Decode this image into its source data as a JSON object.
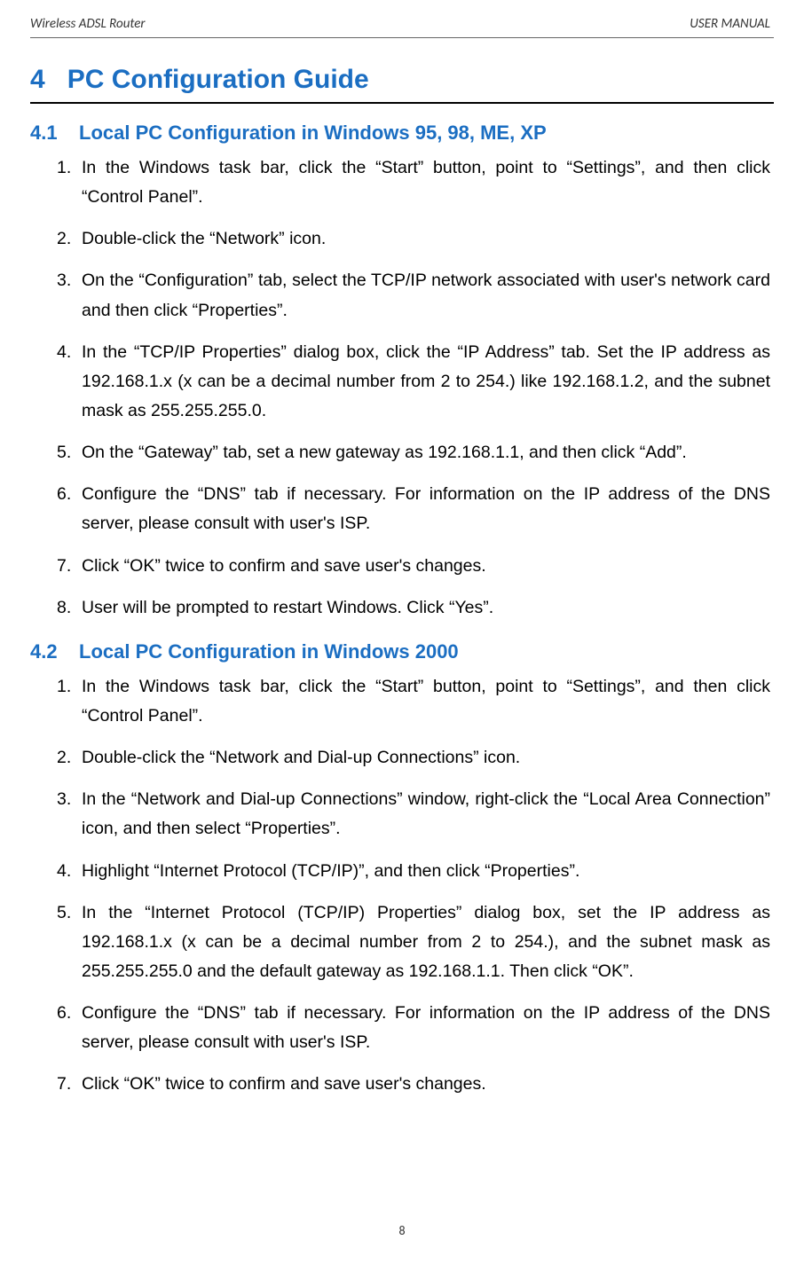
{
  "header": {
    "left": "Wireless ADSL Router",
    "right": "USER MANUAL"
  },
  "chapter": {
    "number": "4",
    "title": "PC Configuration Guide"
  },
  "sections": [
    {
      "number": "4.1",
      "title": "Local PC Configuration in Windows 95, 98, ME, XP",
      "items": [
        "In the Windows task bar, click the “Start” button, point to “Settings”, and then click “Control Panel”.",
        "Double-click the “Network” icon.",
        "On the “Configuration” tab, select the TCP/IP network associated with user's network card and then click “Properties”.",
        "In the “TCP/IP Properties” dialog box, click the “IP Address” tab. Set the IP address as 192.168.1.x (x can be a decimal number from 2 to 254.) like 192.168.1.2, and the subnet mask as 255.255.255.0.",
        "On the “Gateway” tab, set a new gateway as 192.168.1.1, and then click “Add”.",
        "Configure the “DNS” tab if necessary. For information on the IP address of the DNS server, please consult with user's ISP.",
        "Click “OK” twice to confirm and save user's changes.",
        "User will be prompted to restart Windows. Click “Yes”."
      ]
    },
    {
      "number": "4.2",
      "title": "Local PC Configuration in Windows 2000",
      "items": [
        "In the Windows task bar, click the “Start” button, point to “Settings”, and then click “Control Panel”.",
        "Double-click the “Network and Dial-up Connections” icon.",
        "In the “Network and Dial-up Connections” window, right-click the “Local Area Connection” icon, and then select “Properties”.",
        "Highlight “Internet Protocol (TCP/IP)”, and then click “Properties”.",
        "In the “Internet Protocol (TCP/IP) Properties” dialog box, set the IP address as 192.168.1.x (x can be a decimal number from 2 to 254.), and the subnet mask as 255.255.255.0 and the default gateway as 192.168.1.1. Then click “OK”.",
        "Configure the “DNS” tab if necessary. For information on the IP address of the DNS server, please consult with user's ISP.",
        "Click “OK” twice to confirm and save user's changes."
      ]
    }
  ],
  "page_number": "8"
}
